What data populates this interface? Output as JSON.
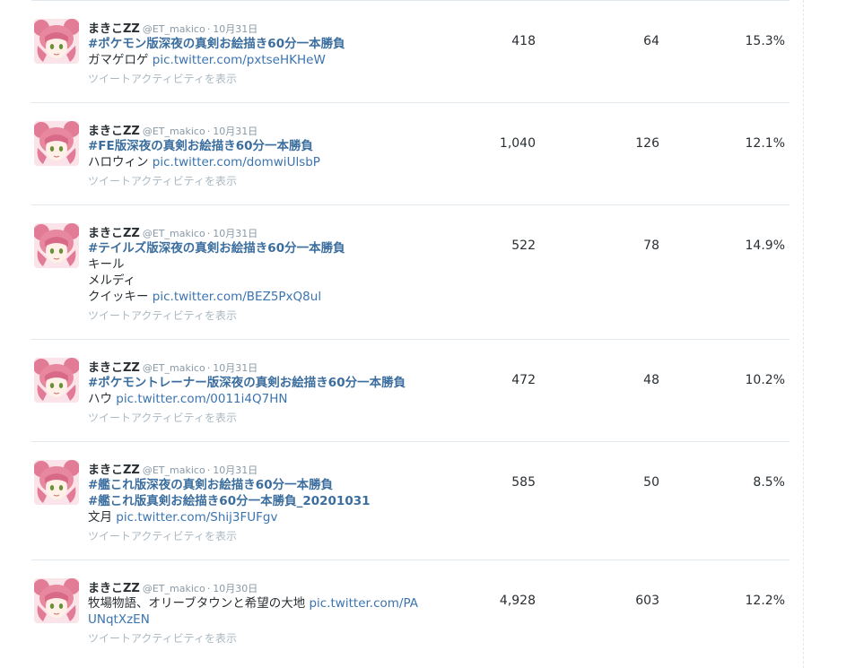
{
  "tweets": [
    {
      "author": "まきこZZ",
      "handle": "@ET_makico",
      "separator": "·",
      "date": "10月31日",
      "lines": [
        {
          "hashtag": "#ポケモン版深夜の真剣お絵描き60分一本勝負",
          "text": "",
          "link": ""
        },
        {
          "hashtag": "",
          "text": "ガマゲロゲ ",
          "link": "pic.twitter.com/pxtseHKHeW"
        }
      ],
      "activity_label": "ツイートアクティビティを表示",
      "impressions": "418",
      "engagements": "64",
      "engagement_rate": "15.3%"
    },
    {
      "author": "まきこZZ",
      "handle": "@ET_makico",
      "separator": "·",
      "date": "10月31日",
      "lines": [
        {
          "hashtag": "#FE版深夜の真剣お絵描き60分一本勝負",
          "text": "",
          "link": ""
        },
        {
          "hashtag": "",
          "text": "ハロウィン ",
          "link": "pic.twitter.com/domwiUlsbP"
        }
      ],
      "activity_label": "ツイートアクティビティを表示",
      "impressions": "1,040",
      "engagements": "126",
      "engagement_rate": "12.1%"
    },
    {
      "author": "まきこZZ",
      "handle": "@ET_makico",
      "separator": "·",
      "date": "10月31日",
      "lines": [
        {
          "hashtag": "#テイルズ版深夜の真剣お絵描き60分一本勝負",
          "text": "",
          "link": ""
        },
        {
          "hashtag": "",
          "text": "キール",
          "link": ""
        },
        {
          "hashtag": "",
          "text": "メルディ",
          "link": ""
        },
        {
          "hashtag": "",
          "text": "クイッキー ",
          "link": "pic.twitter.com/BEZ5PxQ8ul"
        }
      ],
      "activity_label": "ツイートアクティビティを表示",
      "impressions": "522",
      "engagements": "78",
      "engagement_rate": "14.9%"
    },
    {
      "author": "まきこZZ",
      "handle": "@ET_makico",
      "separator": "·",
      "date": "10月31日",
      "lines": [
        {
          "hashtag": "#ポケモントレーナー版深夜の真剣お絵描き60分一本勝負",
          "text": "",
          "link": ""
        },
        {
          "hashtag": "",
          "text": "ハウ ",
          "link": "pic.twitter.com/0011i4Q7HN"
        }
      ],
      "activity_label": "ツイートアクティビティを表示",
      "impressions": "472",
      "engagements": "48",
      "engagement_rate": "10.2%"
    },
    {
      "author": "まきこZZ",
      "handle": "@ET_makico",
      "separator": "·",
      "date": "10月31日",
      "lines": [
        {
          "hashtag": "#艦これ版深夜の真剣お絵描き60分一本勝負",
          "text": "",
          "link": ""
        },
        {
          "hashtag": "#艦これ版真剣お絵描き60分一本勝負_20201031",
          "text": "",
          "link": ""
        },
        {
          "hashtag": "",
          "text": "文月 ",
          "link": "pic.twitter.com/Shij3FUFgv"
        }
      ],
      "activity_label": "ツイートアクティビティを表示",
      "impressions": "585",
      "engagements": "50",
      "engagement_rate": "8.5%"
    },
    {
      "author": "まきこZZ",
      "handle": "@ET_makico",
      "separator": "·",
      "date": "10月30日",
      "lines": [
        {
          "hashtag": "",
          "text": "牧場物語、オリーブタウンと希望の大地 ",
          "link": "pic.twitter.com/PA"
        },
        {
          "hashtag": "",
          "text": "",
          "link": "UNqtXzEN"
        }
      ],
      "activity_label": "ツイートアクティビティを表示",
      "impressions": "4,928",
      "engagements": "603",
      "engagement_rate": "12.2%"
    }
  ]
}
